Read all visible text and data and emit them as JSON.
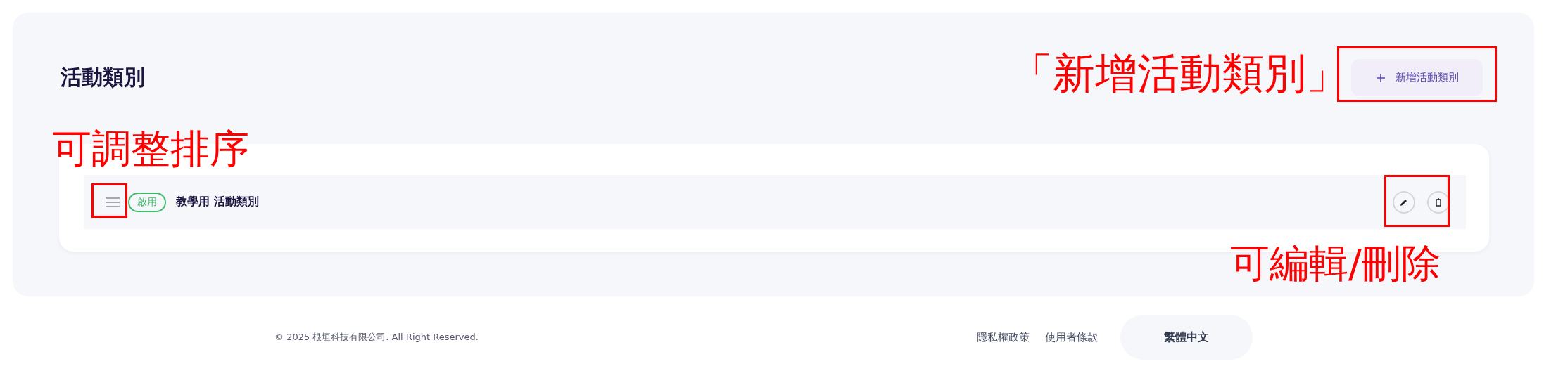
{
  "header": {
    "title": "活動類別",
    "add_button": "新增活動類別"
  },
  "categories": [
    {
      "name": "教學用 活動類別",
      "status": "啟用",
      "enabled": true
    }
  ],
  "footer": {
    "copyright": "© 2025 根垣科技有限公司. All Right Reserved.",
    "links": [
      "隱私權政策",
      "使用者條款"
    ],
    "language": "繁體中文"
  },
  "annotations": [
    {
      "kind": "add",
      "text": "「新增活動類別」"
    },
    {
      "kind": "sort",
      "text": "可調整排序"
    },
    {
      "kind": "actions",
      "text": "可編輯/刪除"
    }
  ]
}
